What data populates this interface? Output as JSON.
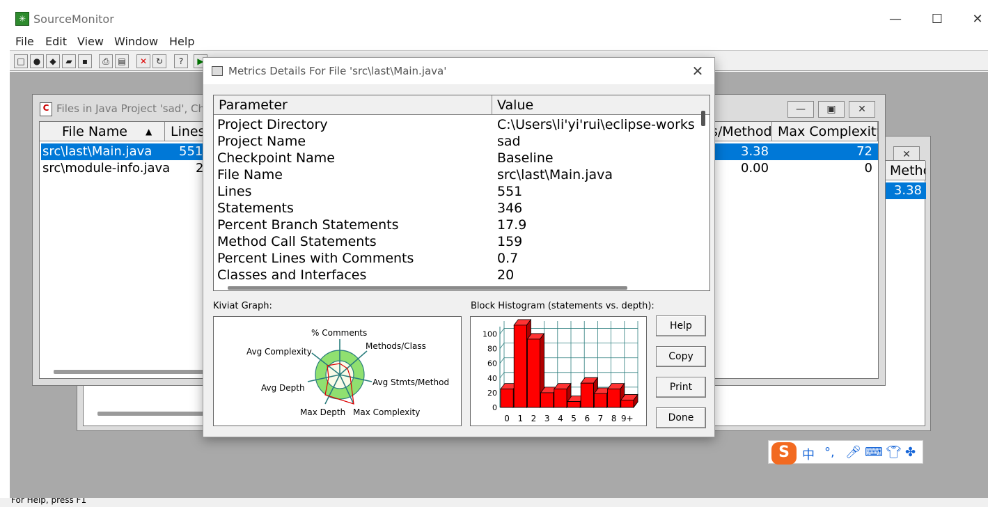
{
  "app": {
    "title": "SourceMonitor",
    "icon": "sourcemonitor-logo-icon",
    "controls": {
      "minimize": "—",
      "maximize": "☐",
      "close": "✕"
    }
  },
  "menu": [
    "File",
    "Edit",
    "View",
    "Window",
    "Help"
  ],
  "toolbar_icons": [
    "new-icon",
    "stop-icon",
    "checkpoint-icon",
    "open-icon",
    "save-icon",
    "print-icon",
    "print-preview-icon",
    "delete-icon",
    "refresh-icon",
    "context-help-icon",
    "run-icon"
  ],
  "files_window": {
    "title": "Files in Java Project 'sad', Che",
    "columns": [
      "File Name",
      "Lines",
      "s/Method",
      "Max Complexity"
    ],
    "rows": [
      {
        "name": "src\\last\\Main.java",
        "lines": "551",
        "per_method": "3.38",
        "max_complexity": "72",
        "selected": true
      },
      {
        "name": "src\\module-info.java",
        "lines": "2",
        "per_method": "0.00",
        "max_complexity": "0",
        "selected": false
      }
    ]
  },
  "back_window": {
    "col_fragment": "Method",
    "value": "3.38"
  },
  "dialog": {
    "title": "Metrics Details For File 'src\\last\\Main.java'",
    "close": "✕",
    "columns": [
      "Parameter",
      "Value"
    ],
    "rows": [
      [
        "Project Directory",
        "C:\\Users\\li'yi'rui\\eclipse-workspac"
      ],
      [
        "Project Name",
        "sad"
      ],
      [
        "Checkpoint Name",
        "Baseline"
      ],
      [
        "File Name",
        "src\\last\\Main.java"
      ],
      [
        "Lines",
        "551"
      ],
      [
        "Statements",
        "346"
      ],
      [
        "Percent Branch Statements",
        "17.9"
      ],
      [
        "Method Call Statements",
        "159"
      ],
      [
        "Percent Lines with Comments",
        "0.7"
      ],
      [
        "Classes and Interfaces",
        "20"
      ]
    ],
    "kiviat_caption": "Kiviat Graph:",
    "histogram_caption": "Block Histogram (statements vs. depth):",
    "kiviat_labels": [
      "% Comments",
      "Methods/Class",
      "Avg Stmts/Method",
      "Max Complexity",
      "Max Depth",
      "Avg Depth",
      "Avg Complexity"
    ],
    "buttons": [
      "Help",
      "Copy",
      "Print",
      "Done"
    ]
  },
  "chart_data": {
    "type": "bar",
    "title": "",
    "categories": [
      "0",
      "1",
      "2",
      "3",
      "4",
      "5",
      "6",
      "7",
      "8",
      "9+"
    ],
    "values": [
      25,
      112,
      93,
      20,
      25,
      8,
      33,
      19,
      25,
      10
    ],
    "ylim": [
      0,
      110
    ],
    "yticks": [
      0,
      20,
      40,
      60,
      80,
      100
    ],
    "grid": true,
    "colors": {
      "bar": "#ff0000",
      "grid": "#2a7d7d"
    }
  },
  "ime": {
    "logo": "S",
    "items": [
      "中",
      "°,",
      "mic-icon",
      "keyboard-icon",
      "skin-icon",
      "apps-icon"
    ]
  },
  "status": "For Help, press F1"
}
